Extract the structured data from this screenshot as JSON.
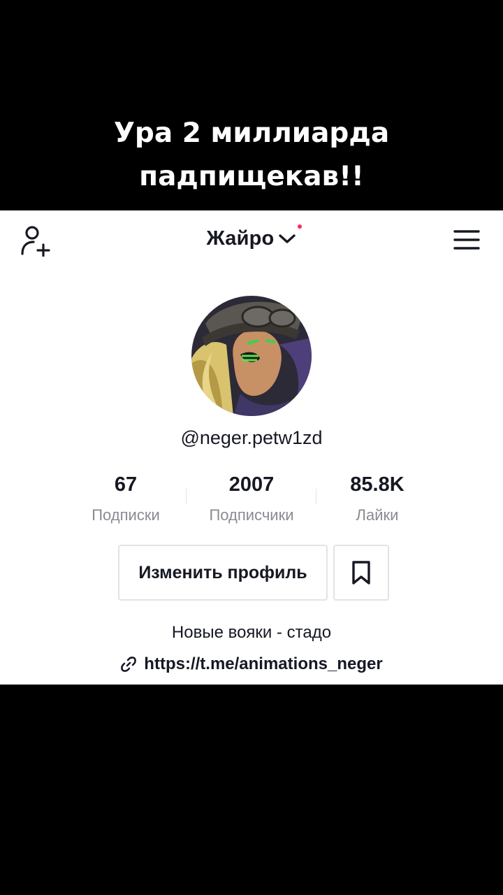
{
  "caption": {
    "line1": "Ура 2 миллиарда",
    "line2": "падпищекав!!"
  },
  "header": {
    "account_name": "Жайро",
    "icons": [
      "add-user-icon",
      "chevron-down-icon",
      "menu-icon"
    ],
    "notification_dot_color": "#fe2c55"
  },
  "profile": {
    "username": "@neger.petw1zd",
    "stats": [
      {
        "value": "67",
        "label": "Подписки"
      },
      {
        "value": "2007",
        "label": "Подписчики"
      },
      {
        "value": "85.8K",
        "label": "Лайки"
      }
    ],
    "edit_button_label": "Изменить профиль",
    "bio": "Новые вояки - стадо",
    "link": "https://t.me/animations_neger"
  },
  "colors": {
    "text_primary": "#161823",
    "text_secondary": "#8a8b91",
    "border": "#e3e3e4"
  }
}
